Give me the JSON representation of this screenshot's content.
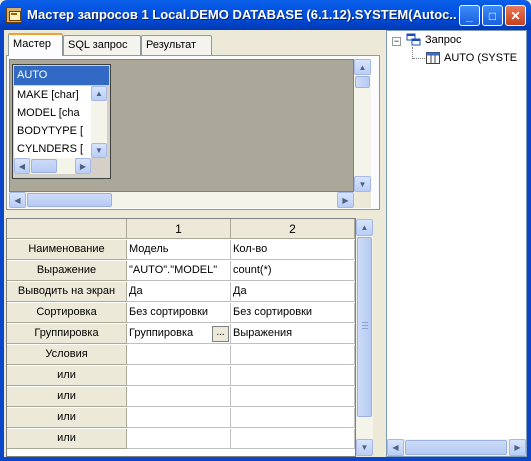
{
  "window": {
    "title": "Мастер запросов 1 Local.DEMO DATABASE (6.1.12).SYSTEM(Autoc...",
    "minimize_label": "_",
    "maximize_label": "□",
    "close_label": "✕"
  },
  "tabs": [
    {
      "label": "Мастер",
      "active": true
    },
    {
      "label": "SQL запрос",
      "active": false
    },
    {
      "label": "Результат",
      "active": false
    }
  ],
  "table_box": {
    "title": "AUTO",
    "fields": [
      "MAKE [char]",
      "MODEL [cha",
      "BODYTYPE [",
      "CYLNDERS ["
    ]
  },
  "grid": {
    "columns": [
      "1",
      "2"
    ],
    "rows": [
      {
        "header": "Наименование",
        "values": [
          "Модель",
          "Кол-во"
        ]
      },
      {
        "header": "Выражение",
        "values": [
          "\"AUTO\".\"MODEL\"",
          "count(*)"
        ]
      },
      {
        "header": "Выводить на экран",
        "values": [
          "Да",
          "Да"
        ]
      },
      {
        "header": "Сортировка",
        "values": [
          "Без сортировки",
          "Без сортировки"
        ]
      },
      {
        "header": "Группировка",
        "values": [
          "Группировка",
          "Выражения"
        ]
      },
      {
        "header": "Условия",
        "values": [
          "",
          ""
        ]
      },
      {
        "header": "или",
        "values": [
          "",
          ""
        ]
      },
      {
        "header": "или",
        "values": [
          "",
          ""
        ]
      },
      {
        "header": "или",
        "values": [
          "",
          ""
        ]
      },
      {
        "header": "или",
        "values": [
          "",
          ""
        ]
      }
    ],
    "ellipsis_label": "..."
  },
  "tree": {
    "expander": "−",
    "root_label": "Запрос",
    "child_label": "AUTO (SYSTE"
  },
  "colors": {
    "titlebar": "#0253e0",
    "selection": "#316ac5",
    "design_bg": "#aca899",
    "window_bg": "#ece9d8"
  },
  "icons": [
    "app-icon",
    "database-icon",
    "table-icon"
  ]
}
